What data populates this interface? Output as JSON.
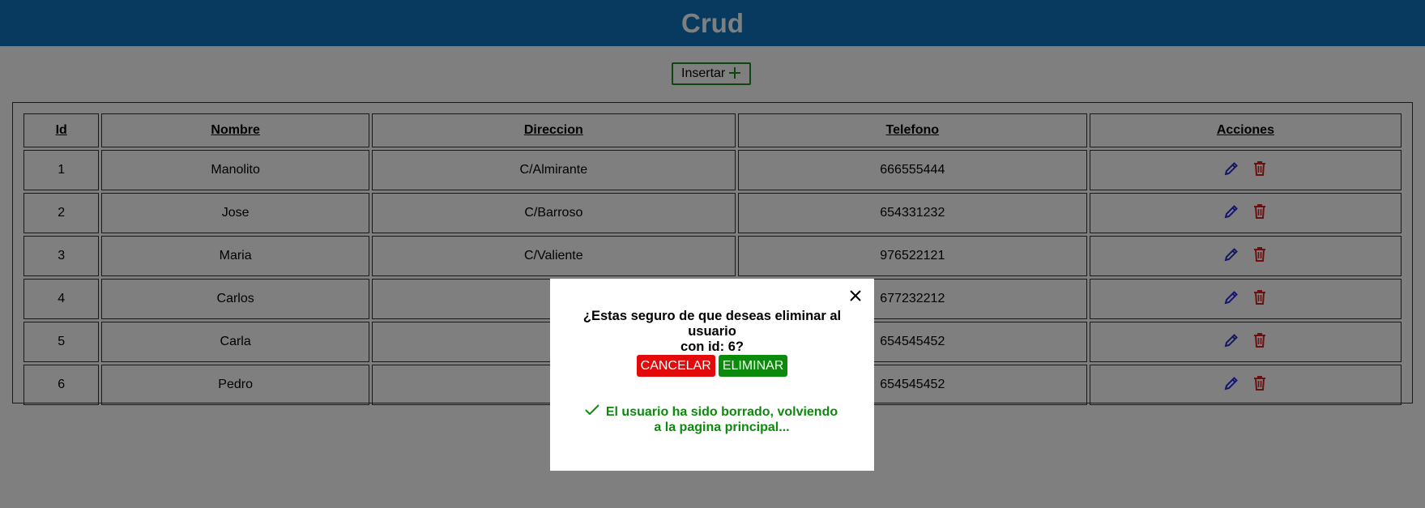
{
  "app": {
    "title": "Crud"
  },
  "toolbar": {
    "insert_label": "Insertar",
    "insert_icon": "plus-icon"
  },
  "table": {
    "headers": [
      "Id",
      "Nombre",
      "Direccion",
      "Telefono",
      "Acciones"
    ],
    "rows": [
      {
        "id": "1",
        "nombre": "Manolito",
        "direccion": "C/Almirante",
        "telefono": "666555444"
      },
      {
        "id": "2",
        "nombre": "Jose",
        "direccion": "C/Barroso",
        "telefono": "654331232"
      },
      {
        "id": "3",
        "nombre": "Maria",
        "direccion": "C/Valiente",
        "telefono": "976522121"
      },
      {
        "id": "4",
        "nombre": "Carlos",
        "direccion": "",
        "telefono": "677232212"
      },
      {
        "id": "5",
        "nombre": "Carla",
        "direccion": "",
        "telefono": "654545452"
      },
      {
        "id": "6",
        "nombre": "Pedro",
        "direccion": "",
        "telefono": "654545452"
      }
    ]
  },
  "modal": {
    "question_line1": "¿Estas seguro de que deseas eliminar al usuario",
    "question_line2": "con id: 6?",
    "cancel_label": "CANCELAR",
    "delete_label": "ELIMINAR",
    "success_line1": "El usuario ha sido borrado, volviendo",
    "success_line2": "a la pagina principal..."
  },
  "colors": {
    "header_bg": "#0f75bc",
    "edit_icon": "#2b2bd6",
    "delete_icon": "#d62020",
    "cancel": "#e20a0a",
    "confirm": "#0b8a0b"
  }
}
